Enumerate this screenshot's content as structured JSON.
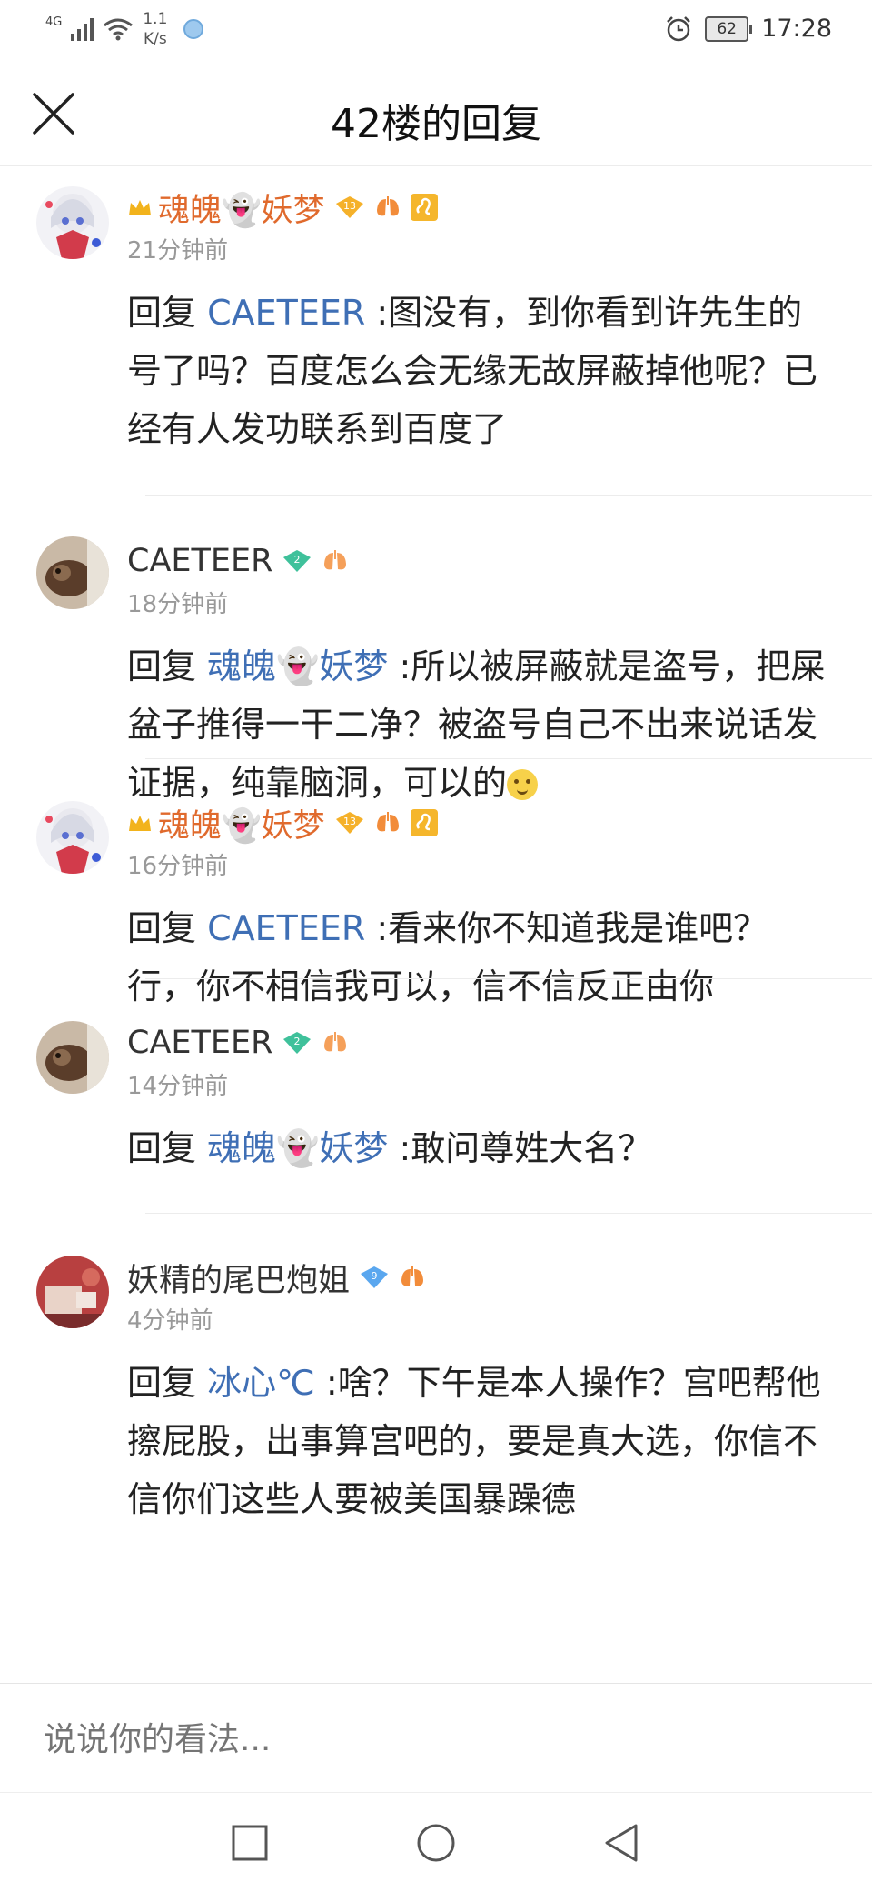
{
  "status_bar": {
    "network": "4G",
    "speed_value": "1.1",
    "speed_unit": "K/s",
    "battery": "62",
    "time": "17:28"
  },
  "header": {
    "title": "42楼的回复"
  },
  "comments": [
    {
      "author": "魂魄👻妖梦",
      "author_style": "admin",
      "level": "13",
      "time": "21分钟前",
      "reply_prefix": "回复 ",
      "mention": "CAETEER",
      "text": " :图没有，到你看到许先生的号了吗？百度怎么会无缘无故屏蔽掉他呢？已经有人发功联系到百度了"
    },
    {
      "author": "CAETEER",
      "author_style": "normal",
      "level": "2",
      "time": "18分钟前",
      "reply_prefix": "回复 ",
      "mention": "魂魄👻妖梦",
      "text": " :所以被屏蔽就是盗号，把屎盆子推得一干二净？被盗号自己不出来说话发证据，纯靠脑洞，可以的"
    },
    {
      "author": "魂魄👻妖梦",
      "author_style": "admin",
      "level": "13",
      "time": "16分钟前",
      "reply_prefix": "回复 ",
      "mention": "CAETEER",
      "text": " :看来你不知道我是谁吧？行，你不相信我可以，信不信反正由你"
    },
    {
      "author": "CAETEER",
      "author_style": "normal",
      "level": "2",
      "time": "14分钟前",
      "reply_prefix": "回复 ",
      "mention": "魂魄👻妖梦",
      "text": " :敢问尊姓大名？"
    },
    {
      "author": "妖精的尾巴炮姐",
      "author_style": "normal",
      "level": "9",
      "time": "4分钟前",
      "reply_prefix": "回复 ",
      "mention": "冰心℃",
      "text": " :啥？下午是本人操作？宫吧帮他擦屁股，出事算宫吧的，要是真大选，你信不信你们这些人要被美国暴躁德"
    }
  ],
  "input": {
    "placeholder": "说说你的看法..."
  },
  "colors": {
    "admin_name": "#e06a2d",
    "mention": "#3f6fb5",
    "time": "#999999"
  },
  "icons": [
    "close-icon",
    "crown-icon",
    "level-badge-icon",
    "lung-icon",
    "zodiac-leo-icon",
    "emoji-smirk-icon",
    "nav-square-icon",
    "nav-circle-icon",
    "nav-back-icon"
  ]
}
